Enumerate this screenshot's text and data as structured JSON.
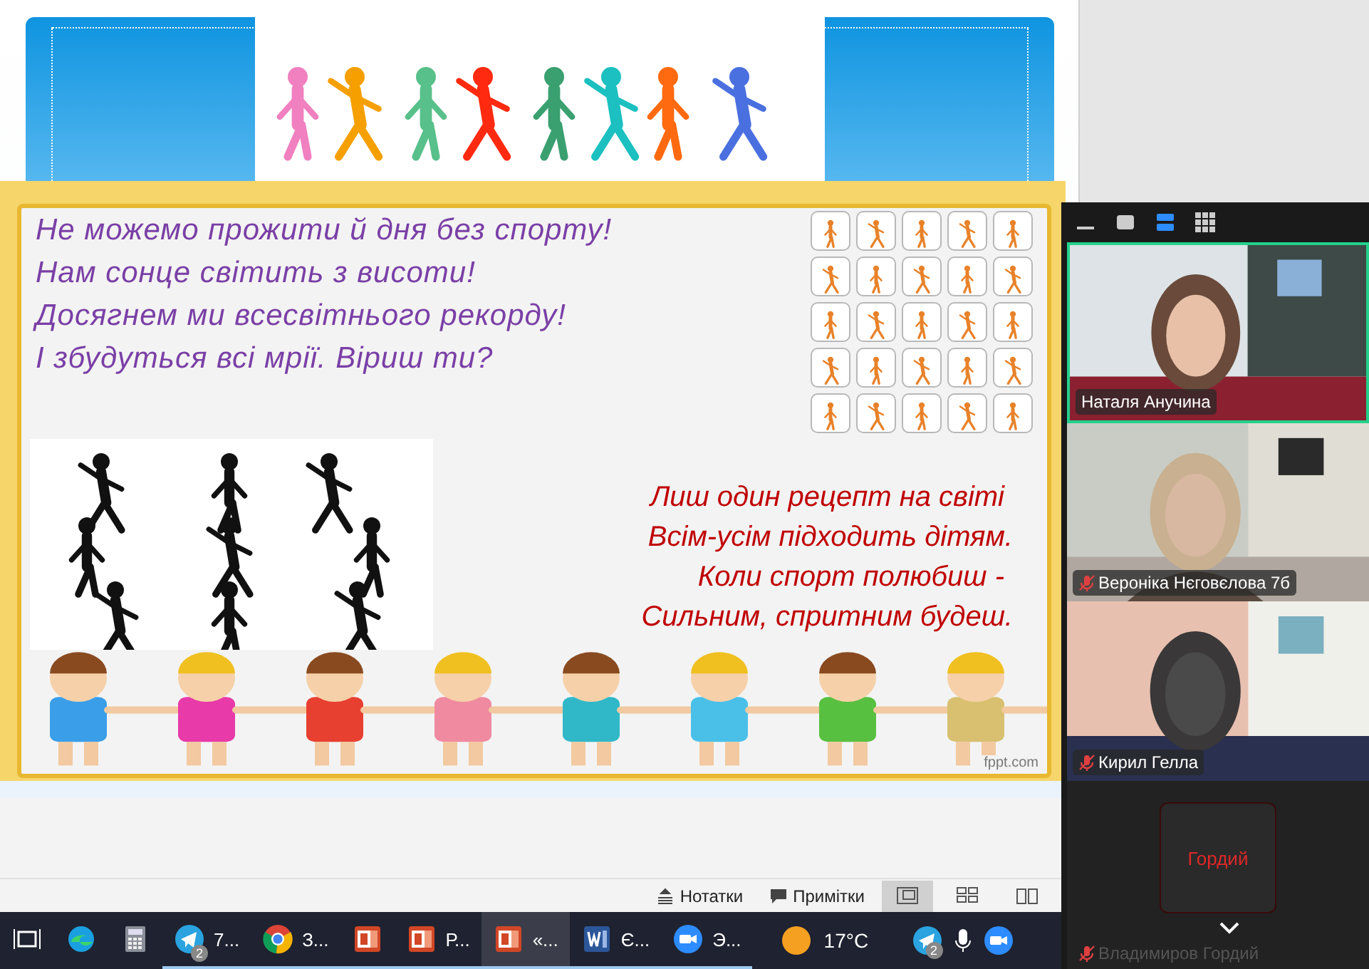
{
  "slide": {
    "verse_lines": [
      "Не можемо прожити й дня без спорту!",
      "Нам сонце світить з висоти!",
      "Досягнем ми всесвітнього рекорду!",
      "І збудуться всі мрії. Віриш ти?"
    ],
    "poem_lines": [
      "Лиш один рецепт на світі",
      "Всім-усім підходить дітям.",
      "Коли спорт полюбиш -",
      "Сильним, спритним будеш."
    ],
    "credit": "fppt.com"
  },
  "status_bar": {
    "buttons": [
      {
        "kind": "notes",
        "label": "Нотатки"
      },
      {
        "kind": "comments",
        "label": "Примітки"
      }
    ],
    "views": [
      {
        "kind": "normal",
        "selected": true
      },
      {
        "kind": "sorter",
        "selected": false
      },
      {
        "kind": "reading",
        "selected": false
      }
    ]
  },
  "taskbar": {
    "apps": [
      {
        "kind": "taskview",
        "running": false,
        "selected": false
      },
      {
        "kind": "edge",
        "running": false,
        "selected": false
      },
      {
        "kind": "calculator",
        "running": false,
        "selected": false
      },
      {
        "kind": "telegram",
        "label": "7...",
        "badge": "2",
        "running": true,
        "selected": false
      },
      {
        "kind": "chrome",
        "label": "З...",
        "running": true,
        "selected": false
      },
      {
        "kind": "powerpoint",
        "running": true,
        "selected": false
      },
      {
        "kind": "powerpoint",
        "label": "Р...",
        "running": true,
        "selected": false
      },
      {
        "kind": "powerpoint",
        "label": "«...",
        "running": true,
        "selected": true
      },
      {
        "kind": "word",
        "label": "Є...",
        "running": true,
        "selected": false
      },
      {
        "kind": "zoom",
        "label": "Э...",
        "running": true,
        "selected": false
      }
    ],
    "weather": "17°C",
    "tray_badge": "2"
  },
  "zoom": {
    "participants": [
      {
        "name": "Наталя Анучина",
        "muted": false,
        "speaking": true,
        "kind": "picture"
      },
      {
        "name": "Вероніка Нєговєлова 7б",
        "muted": true,
        "speaking": false,
        "kind": "picture"
      },
      {
        "name": "Кирил Гелла",
        "muted": true,
        "speaking": false,
        "kind": "picture"
      },
      {
        "name": "Владимиров Гордий",
        "muted": true,
        "speaking": false,
        "kind": "avatar",
        "avatar_text": "Гордий"
      }
    ]
  }
}
